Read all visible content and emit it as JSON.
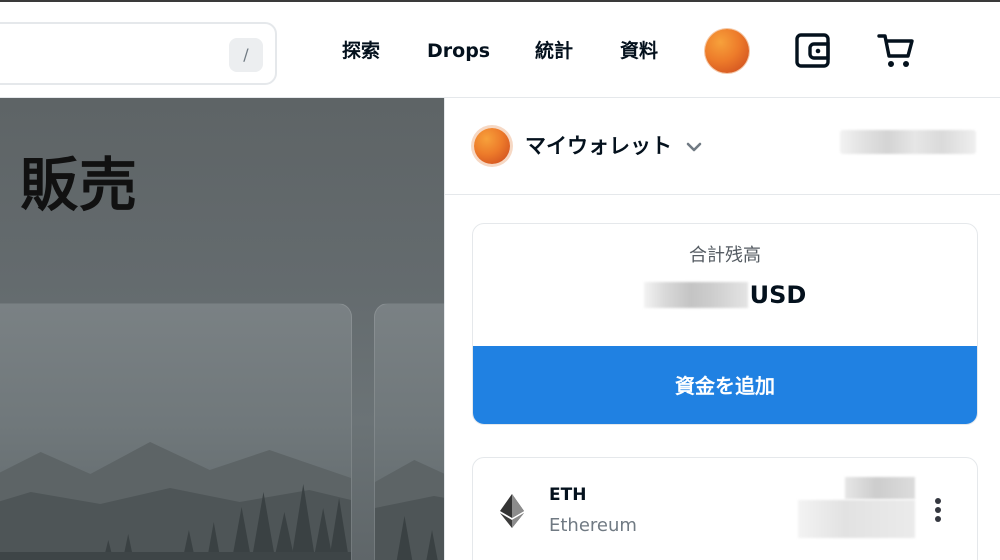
{
  "header": {
    "search": {
      "placeholder": "",
      "value": "",
      "shortcut_key": "/"
    },
    "nav": [
      {
        "label": "探索"
      },
      {
        "label": "Drops"
      },
      {
        "label": "統計"
      },
      {
        "label": "資料"
      }
    ],
    "icons": [
      "avatar",
      "wallet-icon",
      "cart-icon"
    ]
  },
  "page": {
    "title": "販売"
  },
  "wallet": {
    "title": "マイウォレット",
    "address": "",
    "total": {
      "label": "合計残高",
      "amount": "",
      "currency": "USD"
    },
    "add_funds_label": "資金を追加",
    "tokens": [
      {
        "symbol": "ETH",
        "name": "Ethereum",
        "icon": "ethereum-icon",
        "balance": "",
        "balance_usd": ""
      }
    ]
  },
  "colors": {
    "accent": "#2081e2",
    "text_primary": "#04111d",
    "text_secondary": "#707a83",
    "border": "#e5e8eb"
  }
}
